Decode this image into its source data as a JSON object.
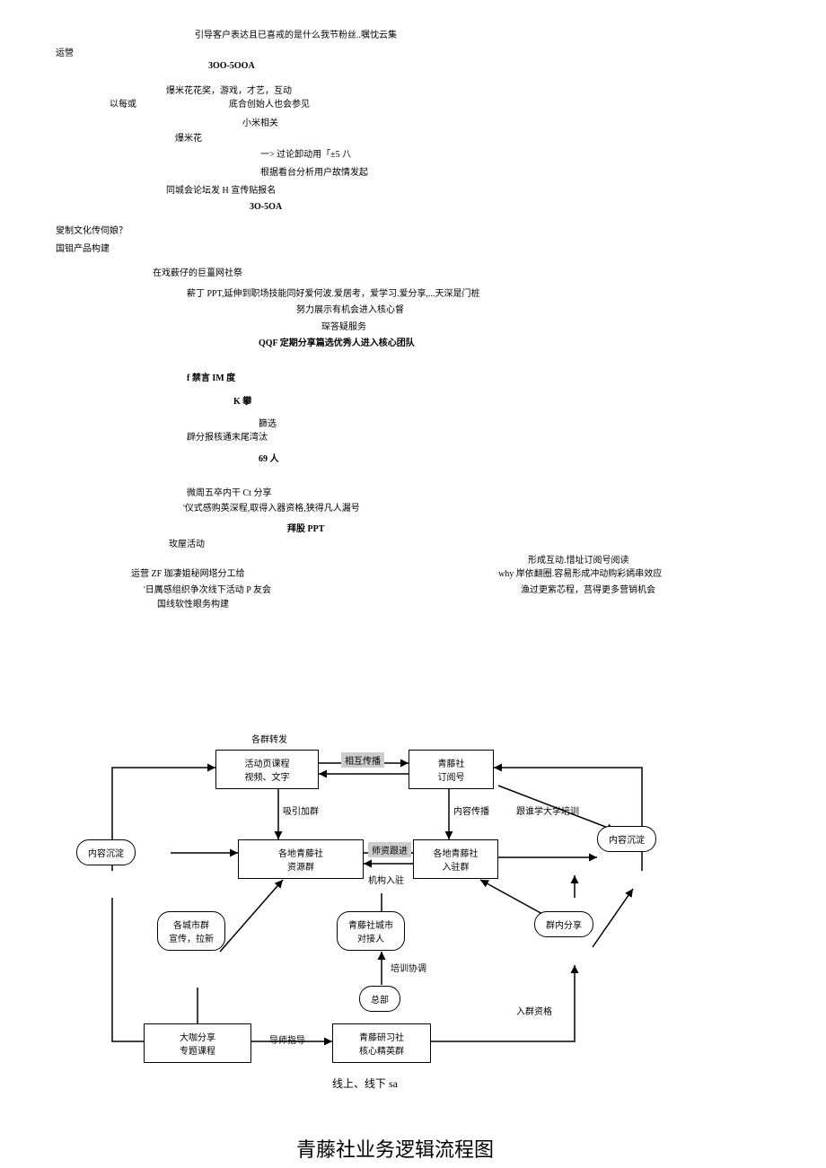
{
  "lines": {
    "l1": "引导客户表达且已喜戒的是什么我节粉丝..嘱忱云集",
    "l2": "运營",
    "l3": "3OO-5OOA",
    "l4": "爆米花花奖，游戏，才艺，互动",
    "l5": "以每或",
    "l6": "底合创始人也会参见",
    "l7": "小米相关",
    "l8": "爆米花",
    "l9": "一> 过论卸动用「±5 八",
    "l10": "根据看台分析用户故情发起",
    "l11": "同城会论坛发 H 宣传贴报名",
    "l12": "3O-5OA",
    "l13": "叟制文化传伺娘？",
    "l14": "国钼产品构建",
    "l15": "在戏薮仔的巨畺网社祭",
    "l16": "薪丁 PPT,延伸到职场技能同好爱何波.爱居考，爱学习.爱分享,...天深是门桩",
    "l17": "努力展示有机会进入核心督",
    "l18": "琛答疑服务",
    "l19": "QQF 定期分享篇选优秀人进入核心团队",
    "l20": "f 禁言 IM 度",
    "l21": "K 攀",
    "l22": "篩选",
    "l23": "辟分报核通末尾湾汰",
    "l24": "69 人",
    "l25": "微周五卒内干 Ct 分享",
    "l26": "'仪式感购英深程,取得入器资格,狭得凡人漏号",
    "l27": "拜股 PPT",
    "l28": "玫屋活动",
    "l29": "形成互动.惜址订阅号阅读",
    "l30": "运营 ZF 珈凄姐秘网塔分工给",
    "l31": "why 岸依翻圈.容易形成冲动购彩嫣串效应",
    "l32": "'日厲感组织争次线下活动 P 友会",
    "l33": "渔过更紫芯程，莒得更多营销机会",
    "l34": "国线软性眼务构建"
  },
  "diagram": {
    "label_groups_forward": "各群转发",
    "node_activity": "活动页课程\n视频、文字",
    "label_mutual": "相互传播",
    "node_qingteng_sub": "青藤社\n订阅号",
    "label_attract": "吸引加群",
    "label_content_spread": "内容传播",
    "label_follow_uni": "跟谁学大学培训",
    "node_content_left": "内容沉淀",
    "node_resource_group": "各地青藤社\n资源群",
    "label_teacher": "师资跟进",
    "node_local_group": "各地青藤社\n入驻群",
    "label_org": "机构入驻",
    "node_content_right": "内容沉淀",
    "node_city_group": "各城市群\n宣传，拉新",
    "node_city_contact": "青藤社城市\n对接人",
    "label_training": "培训协调",
    "node_group_share": "群内分享",
    "node_hq": "总部",
    "label_qualification": "入群资格",
    "node_expert_share": "大咖分享\n专题课程",
    "label_mentor": "导师指导",
    "node_core_group": "青藤研习社\n核心精英群",
    "caption_below": "线上、线下 sa",
    "main_title": "青藤社业务逻辑流程图"
  }
}
